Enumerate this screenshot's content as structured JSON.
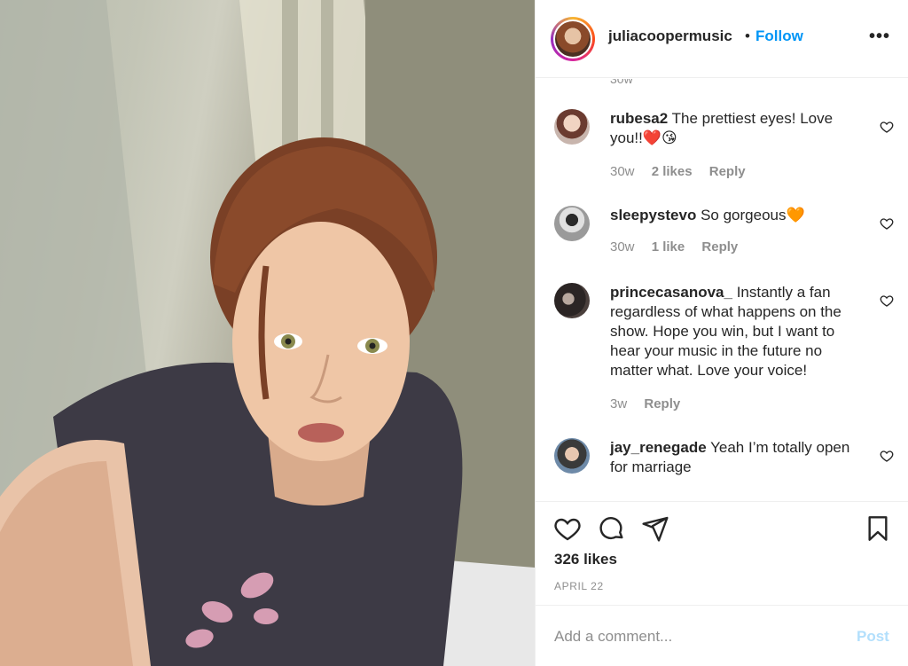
{
  "post": {
    "username": "juliacooper",
    "username_suffix": "music",
    "separator": "•",
    "follow_label": "Follow",
    "more_icon": "more-options-icon",
    "more_glyph": "•••",
    "likes": "326 likes",
    "date": "APRIL 22",
    "comment_placeholder": "Add a comment...",
    "post_label": "Post",
    "accent_color": "#0095f6"
  },
  "comments": [
    {
      "user": "rubesa2",
      "text": "The prettiest eyes! Love you!!",
      "emoji": "❤️😘",
      "age": "30w",
      "likes": "2 likes",
      "reply": "Reply"
    },
    {
      "user": "sleepystevo",
      "text": "So gorgeous",
      "emoji": "🧡",
      "age": "30w",
      "likes": "1 like",
      "reply": "Reply"
    },
    {
      "user": "princecasanova_",
      "text": "Instantly a fan regardless of what happens on the show. Hope you win, but I want to hear your music in the future no matter what. Love your voice!",
      "emoji": "",
      "age": "3w",
      "likes": "",
      "reply": "Reply"
    },
    {
      "user": "jay_renegade",
      "text": "Yeah I’m totally open for marriage",
      "emoji": "",
      "age": "",
      "likes": "",
      "reply": ""
    }
  ]
}
